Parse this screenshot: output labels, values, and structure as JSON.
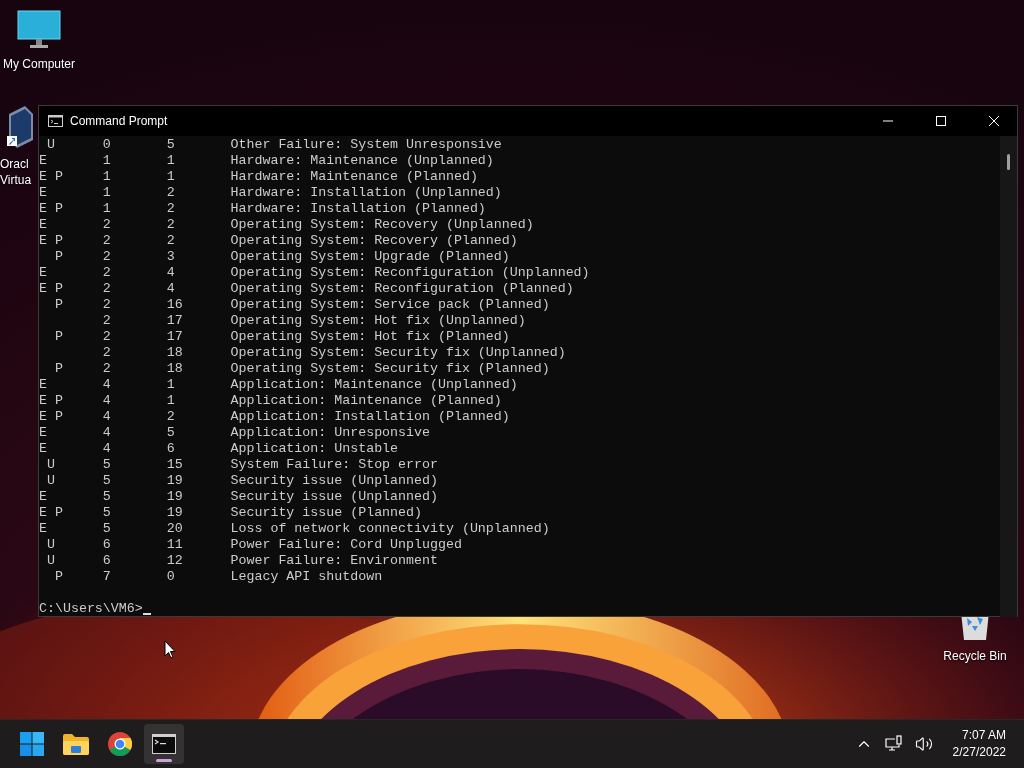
{
  "desktop_icons": [
    {
      "kind": "computer",
      "lines": [
        "My Computer"
      ]
    },
    {
      "kind": "virtualbox",
      "lines": [
        "Oracl",
        "Virtua"
      ]
    },
    {
      "kind": "recycle",
      "lines": [
        "Recycle Bin"
      ]
    }
  ],
  "window": {
    "title": "Command Prompt",
    "output": [
      " U      0       5       Other Failure: System Unresponsive",
      "E       1       1       Hardware: Maintenance (Unplanned)",
      "E P     1       1       Hardware: Maintenance (Planned)",
      "E       1       2       Hardware: Installation (Unplanned)",
      "E P     1       2       Hardware: Installation (Planned)",
      "E       2       2       Operating System: Recovery (Unplanned)",
      "E P     2       2       Operating System: Recovery (Planned)",
      "  P     2       3       Operating System: Upgrade (Planned)",
      "E       2       4       Operating System: Reconfiguration (Unplanned)",
      "E P     2       4       Operating System: Reconfiguration (Planned)",
      "  P     2       16      Operating System: Service pack (Planned)",
      "        2       17      Operating System: Hot fix (Unplanned)",
      "  P     2       17      Operating System: Hot fix (Planned)",
      "        2       18      Operating System: Security fix (Unplanned)",
      "  P     2       18      Operating System: Security fix (Planned)",
      "E       4       1       Application: Maintenance (Unplanned)",
      "E P     4       1       Application: Maintenance (Planned)",
      "E P     4       2       Application: Installation (Planned)",
      "E       4       5       Application: Unresponsive",
      "E       4       6       Application: Unstable",
      " U      5       15      System Failure: Stop error",
      " U      5       19      Security issue (Unplanned)",
      "E       5       19      Security issue (Unplanned)",
      "E P     5       19      Security issue (Planned)",
      "E       5       20      Loss of network connectivity (Unplanned)",
      " U      6       11      Power Failure: Cord Unplugged",
      " U      6       12      Power Failure: Environment",
      "  P     7       0       Legacy API shutdown"
    ],
    "prompt": "C:\\Users\\VM6>"
  },
  "taskbar": {
    "apps": [
      {
        "kind": "start",
        "selected": false
      },
      {
        "kind": "explorer",
        "selected": false
      },
      {
        "kind": "chrome",
        "selected": false
      },
      {
        "kind": "terminal",
        "selected": true
      }
    ],
    "time": "7:07 AM",
    "date": "2/27/2022"
  }
}
